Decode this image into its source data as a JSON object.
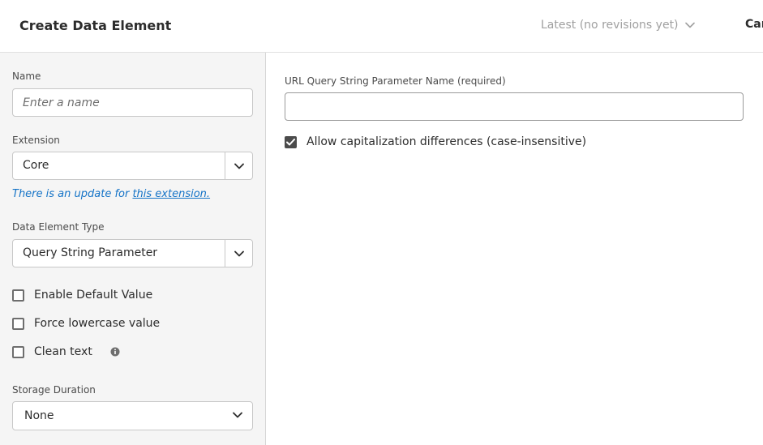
{
  "header": {
    "title": "Create Data Element",
    "revision": "Latest (no revisions yet)",
    "cancel_label": "Car"
  },
  "form": {
    "name": {
      "label": "Name",
      "placeholder": "Enter a name",
      "value": ""
    },
    "extension": {
      "label": "Extension",
      "value": "Core",
      "update_text": "There is an update for ",
      "update_link": "this extension."
    },
    "data_element_type": {
      "label": "Data Element Type",
      "value": "Query String Parameter"
    },
    "options": [
      {
        "label": "Enable Default Value",
        "checked": false
      },
      {
        "label": "Force lowercase value",
        "checked": false
      },
      {
        "label": "Clean text",
        "checked": false
      }
    ],
    "storage_duration": {
      "label": "Storage Duration",
      "value": "None"
    }
  },
  "settings": {
    "param_label": "URL Query String Parameter Name (required)",
    "param_value": "",
    "case_insensitive_label": "Allow capitalization differences (case-insensitive)",
    "case_insensitive_checked": true
  },
  "colors": {
    "link": "#1473c7",
    "left_panel_bg": "#f5f5f5",
    "muted_text": "#a0a0a0"
  }
}
